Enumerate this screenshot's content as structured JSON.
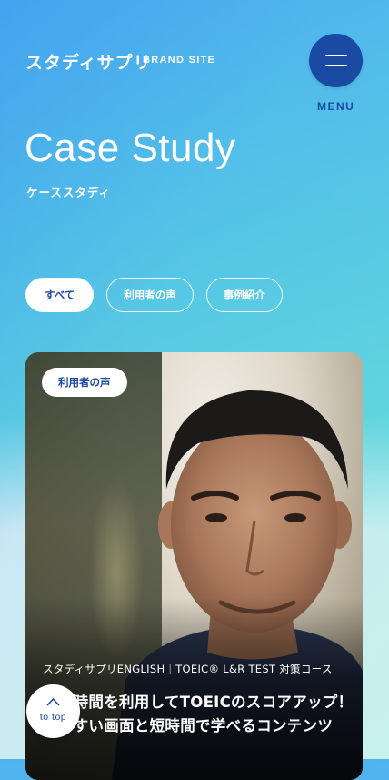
{
  "header": {
    "logo_text": "スタディサプリ",
    "brand_site": "BRAND SITE",
    "menu_label": "MENU"
  },
  "page": {
    "title": "Case Study",
    "subtitle": "ケーススタディ"
  },
  "filters": [
    {
      "label": "すべて",
      "active": true
    },
    {
      "label": "利用者の声",
      "active": false
    },
    {
      "label": "事例紹介",
      "active": false
    }
  ],
  "card": {
    "tag": "利用者の声",
    "course": "スタディサプリENGLISH｜TOEIC® L&R TEST 対策コース",
    "title": "隙間時間を利用してTOEICのスコアアップ！見やすい画面と短時間で学べるコンテンツ"
  },
  "to_top": {
    "label": "to top",
    "icon": "chevron-up-icon"
  },
  "colors": {
    "brand_blue": "#1b4aa2",
    "bg_top": "#4fb3ef",
    "bg_mid": "#5fd3df",
    "white": "#ffffff"
  }
}
